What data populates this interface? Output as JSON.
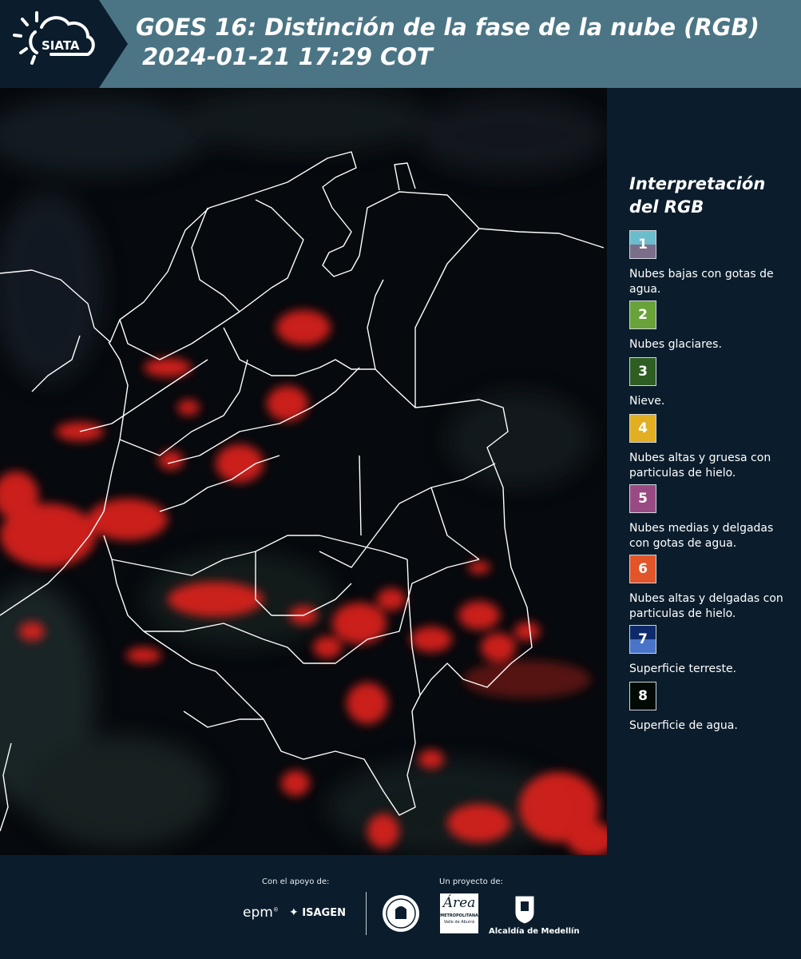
{
  "header": {
    "logo_text": "SIATA",
    "title_line1": "GOES 16: Distinción de la fase de la nube (RGB)",
    "title_line2": "2024-01-21 17:29 COT"
  },
  "legend": {
    "heading": "Interpretación\ndel RGB",
    "items": [
      {
        "num": "1",
        "label": "Nubes bajas con gotas de agua.",
        "color_top": "#6bbccc",
        "color_bottom": "#7a6e8a"
      },
      {
        "num": "2",
        "label": "Nubes glaciares.",
        "color_top": "#6aa23a",
        "color_bottom": "#6aa23a"
      },
      {
        "num": "3",
        "label": "Nieve.",
        "color_top": "#2e5e22",
        "color_bottom": "#2e5e22"
      },
      {
        "num": "4",
        "label": "Nubes altas y gruesa con particulas de hielo.",
        "color_top": "#e2ae22",
        "color_bottom": "#e2ae22"
      },
      {
        "num": "5",
        "label": "Nubes medias y delgadas con gotas de agua.",
        "color_top": "#9a4a82",
        "color_bottom": "#9a4a82"
      },
      {
        "num": "6",
        "label": "Nubes altas y delgadas con particulas de hielo.",
        "color_top": "#e2542a",
        "color_bottom": "#e2542a"
      },
      {
        "num": "7",
        "label": "Superficie terreste.",
        "color_top": "#0e2a6a",
        "color_bottom": "#4a74c8"
      },
      {
        "num": "8",
        "label": "Superficie de agua.",
        "color_top": "#020a06",
        "color_bottom": "#020a06"
      }
    ]
  },
  "footer": {
    "support_label": "Con el apoyo de:",
    "project_label": "Un proyecto de:",
    "epm": "epm",
    "isagen": "ISAGEN",
    "area_word": "Área",
    "area_sub1": "METROPOLITANA",
    "area_sub2": "Valle de Aburrá",
    "alcaldia": "Alcaldía de Medellín"
  }
}
